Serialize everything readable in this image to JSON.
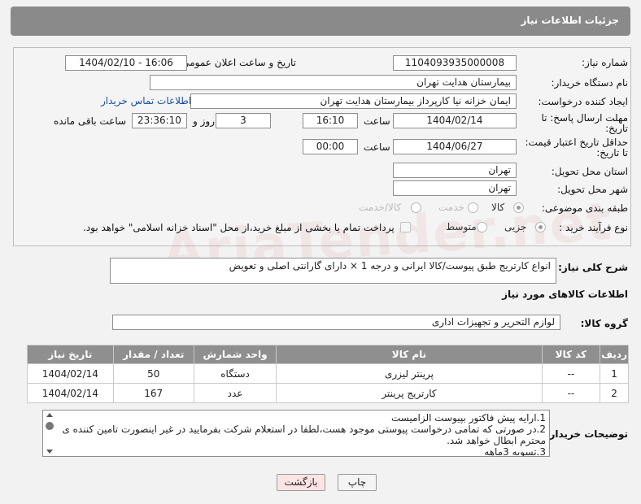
{
  "header": {
    "title": "جزئیات اطلاعات نیاز"
  },
  "form": {
    "need_number": {
      "label": "شماره نیاز:",
      "value": "1104093935000008"
    },
    "announce": {
      "label": "تاریخ و ساعت اعلان عمومی:",
      "value": "1404/02/10 - 16:06"
    },
    "buyer_org": {
      "label": "نام دستگاه خریدار:",
      "value": "بیمارستان هدایت تهران"
    },
    "requester": {
      "label": "ایجاد کننده درخواست:",
      "value": "ایمان خزانه نیا کارپرداز بیمارستان هدایت تهران",
      "contact_link": "اطلاعات تماس خریدار"
    },
    "deadline": {
      "label_line1": "مهلت ارسال پاسخ: تا",
      "label_line2": "تاریخ:",
      "date": "1404/02/14",
      "time_label": "ساعت",
      "time": "16:10",
      "days": "3",
      "days_label": "روز و",
      "remaining": "23:36:10",
      "remaining_label": "ساعت باقی مانده"
    },
    "price_validity": {
      "label_line1": "حداقل تاریخ اعتبار قیمت:",
      "label_line2": "تا تاریخ:",
      "date": "1404/06/27",
      "time_label": "ساعت",
      "time": "00:00"
    },
    "province": {
      "label": "استان محل تحویل:",
      "value": "تهران"
    },
    "city": {
      "label": "شهر محل تحویل:",
      "value": "تهران"
    },
    "category": {
      "label": "طبقه بندی موضوعی:",
      "options": [
        "کالا",
        "خدمت",
        "کالا/خدمت"
      ],
      "selected": "کالا"
    },
    "process": {
      "label": "نوع فرآیند خرید :",
      "options": [
        "جزیی",
        "متوسط"
      ],
      "selected": "جزیی",
      "payment_note": "پرداخت تمام یا بخشی از مبلغ خرید،از محل \"اسناد خزانه اسلامی\" خواهد بود."
    }
  },
  "summary": {
    "label": "شرح کلی نیاز:",
    "value": "انواع کارتریج طبق پیوست/کالا ایرانی و درجه 1 × دارای گارانتی اصلی و تعویض"
  },
  "goods_section": {
    "title": "اطلاعات کالاهای مورد نیاز",
    "group_label": "گروه کالا:",
    "group_value": "لوازم التحریر و تجهیزات اداری"
  },
  "table": {
    "headers": [
      "ردیف",
      "کد کالا",
      "نام کالا",
      "واحد شمارش",
      "تعداد / مقدار",
      "تاریخ نیاز"
    ],
    "rows": [
      [
        "1",
        "--",
        "پرینتر لیزری",
        "دستگاه",
        "50",
        "1404/02/14"
      ],
      [
        "2",
        "--",
        "کارتریج پرینتر",
        "عدد",
        "167",
        "1404/02/14"
      ]
    ]
  },
  "buyer_notes": {
    "label": "توضیحات خریدار:",
    "lines": [
      "1.ارایه پیش فاکتور بپیوست الزامیست",
      "2.در صورتی که تمامی درخواست پیوستی موجود هست،لطفا در استعلام شرکت بفرمایید در غیر اینصورت تامین کننده ی",
      "محترم ابطال خواهد شد.",
      "3.تسویه 3ماهه"
    ]
  },
  "buttons": {
    "print": "چاپ",
    "back": "بازگشت"
  },
  "watermark": "AriaTender.net",
  "colors": {
    "header_bg": "#8a8a8a",
    "link": "#1a4fa0",
    "back_button_bg": "#fde4e4"
  }
}
